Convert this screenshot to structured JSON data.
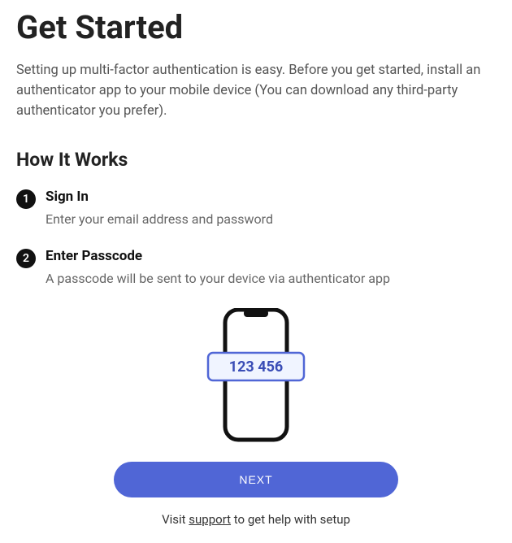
{
  "header": {
    "title": "Get Started",
    "intro": "Setting up multi-factor authentication is easy. Before you get started, install an authenticator app to your mobile device (You can download any third-party authenticator you prefer)."
  },
  "section": {
    "title": "How It Works"
  },
  "steps": [
    {
      "num": "1",
      "title": "Sign In",
      "desc": "Enter your email address and password"
    },
    {
      "num": "2",
      "title": "Enter Passcode",
      "desc": "A passcode will be sent to your device via authenticator app"
    }
  ],
  "illustration": {
    "code": "123 456"
  },
  "buttons": {
    "next": "NEXT"
  },
  "footer": {
    "prefix": "Visit ",
    "link": "support",
    "suffix": " to get help with setup"
  }
}
